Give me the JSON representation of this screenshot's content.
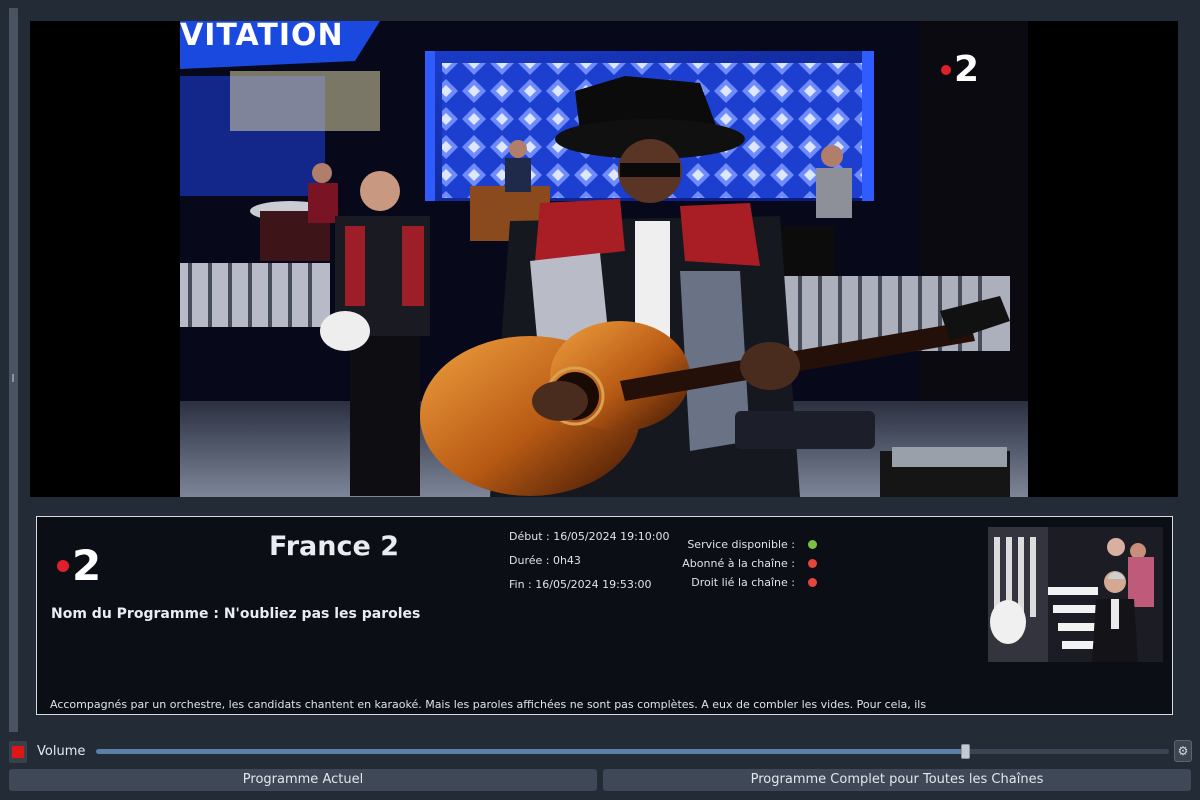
{
  "player": {
    "video": {
      "channel_logo_text": "2",
      "banner_text": "VITATION"
    }
  },
  "info": {
    "logo_text": "2",
    "channel_name": "France 2",
    "program_name": "Nom du Programme : N'oubliez pas les paroles",
    "start": "Début : 16/05/2024 19:10:00",
    "duration": "Durée : 0h43",
    "end": "Fin : 16/05/2024 19:53:00",
    "status": [
      {
        "label": "Service disponible :",
        "color": "#7bc043"
      },
      {
        "label": "Abonné à la chaîne :",
        "color": "#e8453c"
      },
      {
        "label": "Droit lié la chaîne :",
        "color": "#e8453c"
      }
    ],
    "description": "Accompagnés par un orchestre, les candidats chantent en karaoké. Mais les paroles affichées ne sont pas complètes. A eux de combler les vides. Pour cela, ils"
  },
  "controls": {
    "volume_label": "Volume",
    "volume_level": 0.81,
    "settings_icon": "⚙"
  },
  "buttons": {
    "current_program": "Programme Actuel",
    "full_program": "Programme Complet pour Toutes les Chaînes"
  },
  "colors": {
    "accent": "#5d7ea6",
    "stop": "#e01515",
    "logo_red": "#e01f2d"
  }
}
